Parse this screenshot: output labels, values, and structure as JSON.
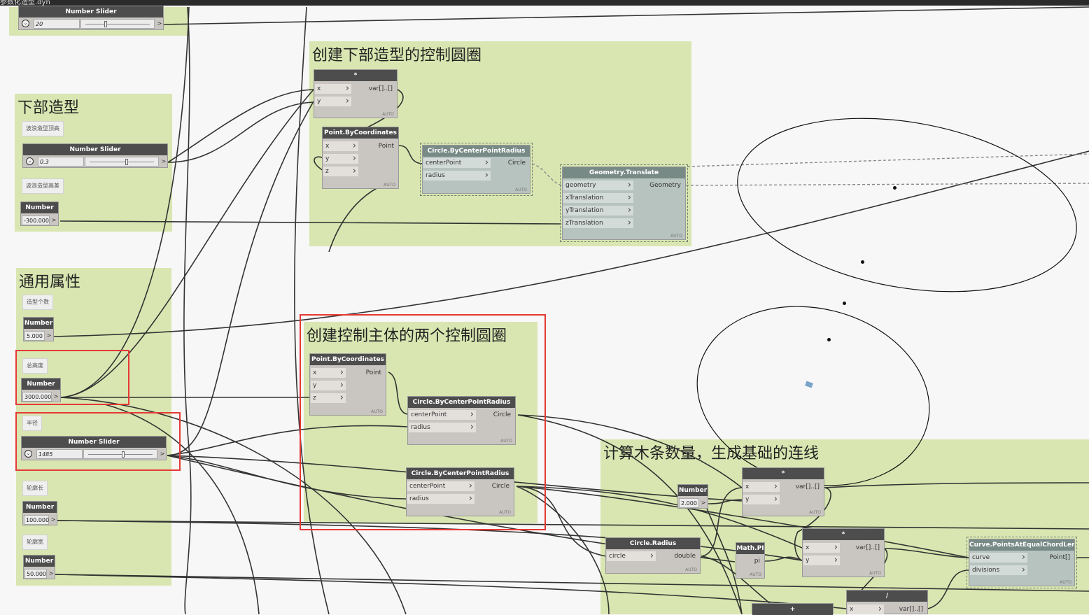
{
  "window": {
    "tab_title": "参数化造型.dyn"
  },
  "groups": {
    "lower_form": {
      "title": "下部造型"
    },
    "common": {
      "title": "通用属性"
    },
    "lower_circle": {
      "title": "创建下部造型的控制圆圈"
    },
    "main_circles": {
      "title": "创建控制主体的两个控制圆圈"
    },
    "count": {
      "title": "计算木条数量，生成基础的连线"
    }
  },
  "notes": {
    "wave_top": "波浪造型顶高",
    "wave_diff": "波浪造型高差",
    "form_count": "造型个数",
    "total_height": "总高度",
    "radius": "半径",
    "contour_len": "轮廓长",
    "contour_width": "轮廓宽"
  },
  "nodes": {
    "slider_top": {
      "title": "Number Slider",
      "value": "20",
      "position": 0.32
    },
    "slider_03": {
      "title": "Number Slider",
      "value": "0.3",
      "position": 0.55
    },
    "num_neg300": {
      "title": "Number",
      "value": "-300.000"
    },
    "num_5": {
      "title": "Number",
      "value": "5.000"
    },
    "num_3000": {
      "title": "Number",
      "value": "3000.000"
    },
    "slider_1485": {
      "title": "Number Slider",
      "value": "1485",
      "position": 0.52
    },
    "num_100": {
      "title": "Number",
      "value": "100.000"
    },
    "num_50": {
      "title": "Number",
      "value": "50.000"
    },
    "num_2": {
      "title": "Number",
      "value": "2.000"
    },
    "mul_top": {
      "title": "*",
      "in": [
        "x",
        "y"
      ],
      "out": "var[]..[]"
    },
    "pt1": {
      "title": "Point.ByCoordinates",
      "in": [
        "x",
        "y",
        "z"
      ],
      "out": "Point"
    },
    "circ1": {
      "title": "Circle.ByCenterPointRadius",
      "in": [
        "centerPoint",
        "radius"
      ],
      "out": "Circle"
    },
    "geo_tr": {
      "title": "Geometry.Translate",
      "in": [
        "geometry",
        "xTranslation",
        "yTranslation",
        "zTranslation"
      ],
      "out": "Geometry"
    },
    "pt2": {
      "title": "Point.ByCoordinates",
      "in": [
        "x",
        "y",
        "z"
      ],
      "out": "Point"
    },
    "circ2": {
      "title": "Circle.ByCenterPointRadius",
      "in": [
        "centerPoint",
        "radius"
      ],
      "out": "Circle"
    },
    "circ3": {
      "title": "Circle.ByCenterPointRadius",
      "in": [
        "centerPoint",
        "radius"
      ],
      "out": "Circle"
    },
    "mul2": {
      "title": "*",
      "in": [
        "x",
        "y"
      ],
      "out": "var[]..[]"
    },
    "circ_radius": {
      "title": "Circle.Radius",
      "in": [
        "circle"
      ],
      "out": "double"
    },
    "math_pi": {
      "title": "Math.PI",
      "out": "pi"
    },
    "mul3": {
      "title": "*",
      "in": [
        "x",
        "y"
      ],
      "out": "var[]..[]"
    },
    "curve_pts": {
      "title": "Curve.PointsAtEqualChordLength",
      "in": [
        "curve",
        "divisions"
      ],
      "out": "Point[]"
    },
    "div": {
      "title": "/",
      "in": [
        "x"
      ],
      "out": "var[]..[]"
    },
    "plus": {
      "title": "+"
    }
  },
  "auto_label": "AUTO",
  "icons": {
    "slider_toggle": "chevron-down-icon",
    "increment": "›"
  }
}
